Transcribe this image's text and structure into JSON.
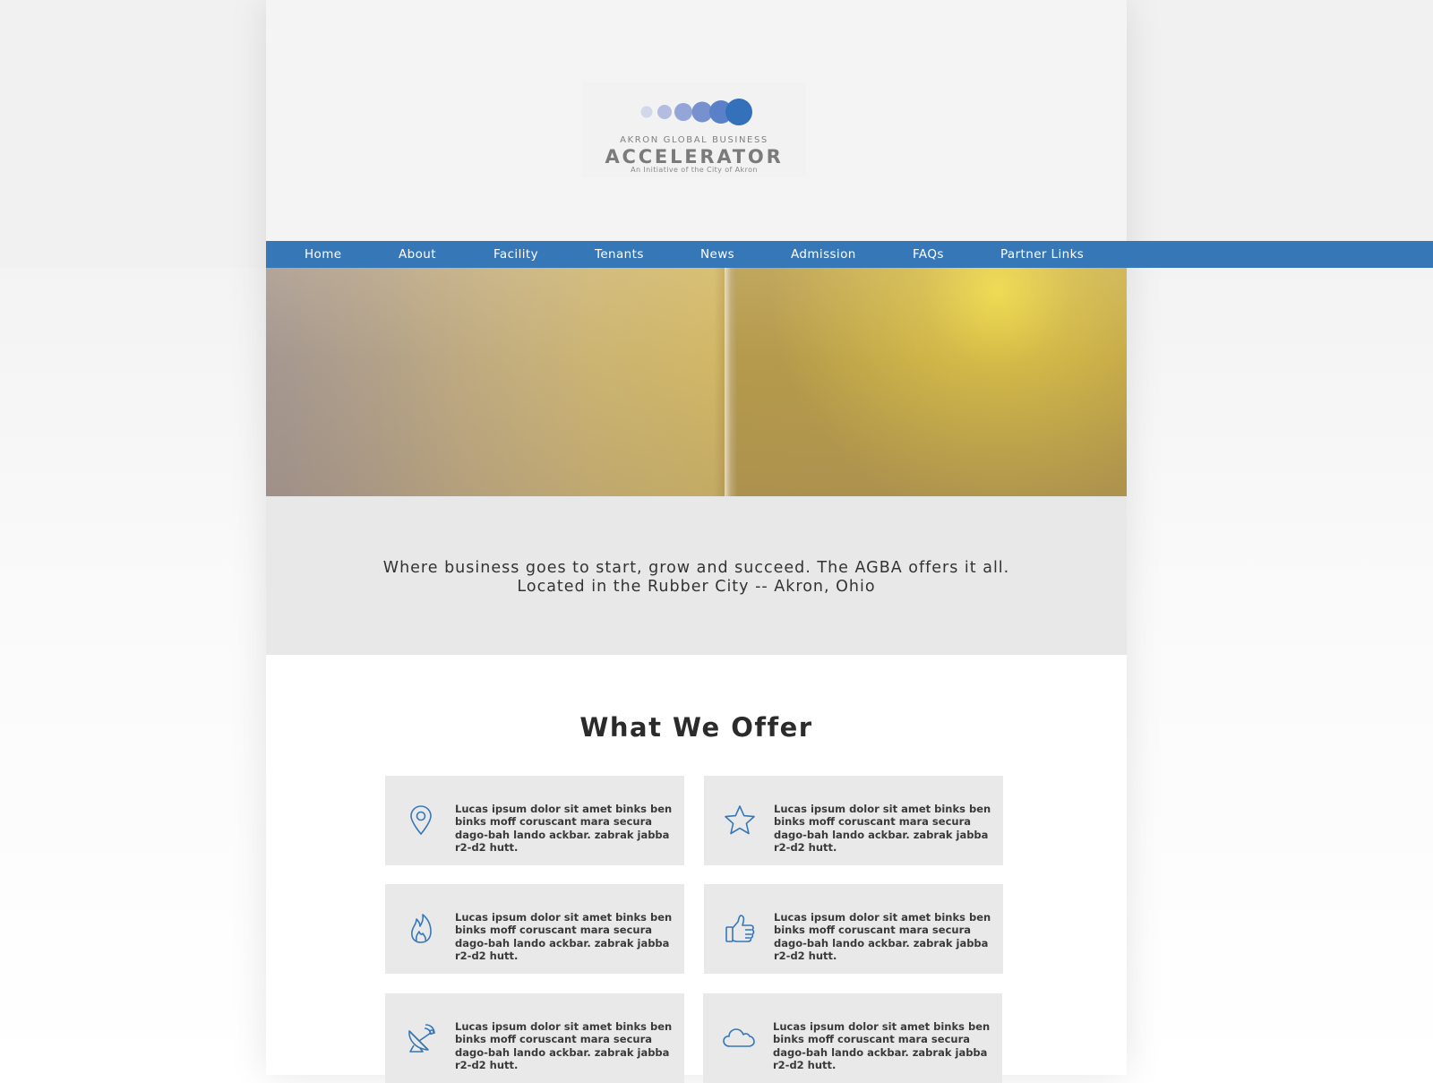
{
  "brand": {
    "line1": "AKRON GLOBAL BUSINESS",
    "line2": "ACCELERATOR",
    "line3": "An Initiative of the City of Akron"
  },
  "nav": {
    "items": [
      {
        "label": "Home"
      },
      {
        "label": "About"
      },
      {
        "label": "Facility"
      },
      {
        "label": "Tenants"
      },
      {
        "label": "News"
      },
      {
        "label": "Admission"
      },
      {
        "label": "FAQs"
      },
      {
        "label": "Partner Links"
      }
    ]
  },
  "tagline": {
    "line1": "Where business goes to start, grow and succeed. The AGBA offers it all.",
    "line2": "Located in the Rubber City -- Akron, Ohio"
  },
  "offer": {
    "title": "What We Offer",
    "cards": [
      {
        "icon": "map-pin-icon",
        "text": "Lucas ipsum dolor sit amet binks ben binks moff coruscant mara secura dago-bah lando ackbar. zabrak jabba r2-d2 hutt."
      },
      {
        "icon": "star-icon",
        "text": "Lucas ipsum dolor sit amet binks ben binks moff coruscant mara secura dago-bah lando ackbar. zabrak jabba r2-d2 hutt."
      },
      {
        "icon": "flame-icon",
        "text": "Lucas ipsum dolor sit amet binks ben binks moff coruscant mara secura dago-bah lando ackbar. zabrak jabba r2-d2 hutt."
      },
      {
        "icon": "thumbs-up-icon",
        "text": "Lucas ipsum dolor sit amet binks ben binks moff coruscant mara secura dago-bah lando ackbar. zabrak jabba r2-d2 hutt."
      },
      {
        "icon": "satellite-dish-icon",
        "text": "Lucas ipsum dolor sit amet binks ben binks moff coruscant mara secura dago-bah lando ackbar. zabrak jabba r2-d2 hutt."
      },
      {
        "icon": "cloud-icon",
        "text": "Lucas ipsum dolor sit amet binks ben binks moff coruscant mara secura dago-bah lando ackbar. zabrak jabba r2-d2 hutt."
      }
    ]
  },
  "colors": {
    "nav": "#3677b8",
    "icon": "#3677b8",
    "band": "#e8e8e8",
    "card": "#e9e9e9"
  }
}
